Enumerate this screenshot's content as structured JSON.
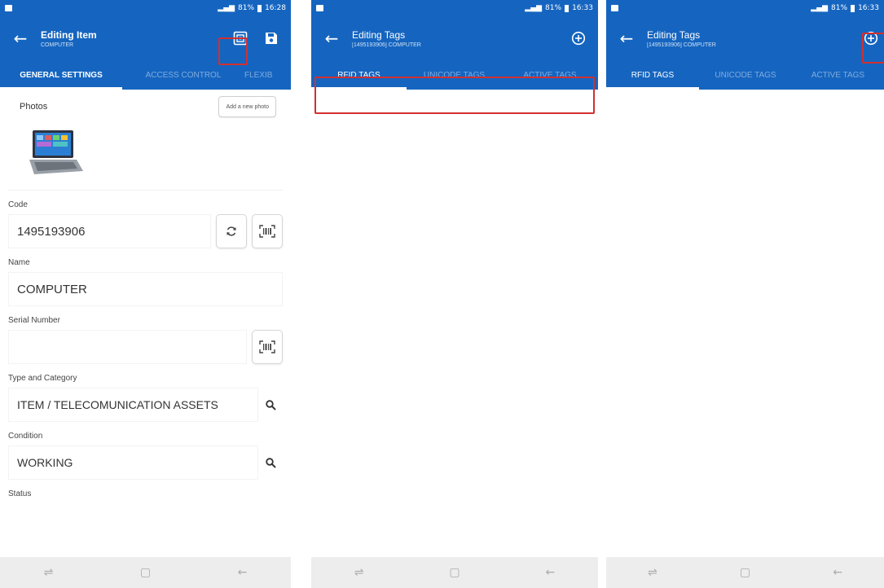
{
  "status_bar": {
    "time_1": "16:28",
    "time_2": "16:33",
    "time_3": "16:33",
    "battery": "81%"
  },
  "screen1": {
    "title": "Editing Item",
    "subtitle": "COMPUTER",
    "tabs": [
      "GENERAL SETTINGS",
      "ACCESS CONTROL",
      "FLEXIB"
    ],
    "photos_label": "Photos",
    "add_photo_label": "Add a new photo",
    "fields": {
      "code_label": "Code",
      "code_value": "1495193906",
      "name_label": "Name",
      "name_value": "COMPUTER",
      "serial_label": "Serial Number",
      "serial_value": "",
      "type_label": "Type and Category",
      "type_value": "ITEM / TELECOMUNICATION ASSETS",
      "condition_label": "Condition",
      "condition_value": "WORKING",
      "status_label": "Status"
    }
  },
  "screen2": {
    "title": "Editing Tags",
    "subtitle": "[1495193906] COMPUTER",
    "tabs": [
      "RFID TAGS",
      "UNICODE TAGS",
      "ACTIVE TAGS"
    ]
  },
  "screen3": {
    "title": "Editing Tags",
    "subtitle": "[1495193906] COMPUTER",
    "tabs": [
      "RFID TAGS",
      "UNICODE TAGS",
      "ACTIVE TAGS"
    ]
  },
  "icons": {
    "back": "arrow-left-icon",
    "tags": "tag-box-icon",
    "save": "floppy-save-icon",
    "add": "plus-circle-icon",
    "refresh": "refresh-icon",
    "barcode": "barcode-scan-icon",
    "search": "magnifier-icon"
  },
  "colors": {
    "primary": "#1565c0",
    "highlight": "#d32f2f",
    "navbar": "#ededed"
  }
}
